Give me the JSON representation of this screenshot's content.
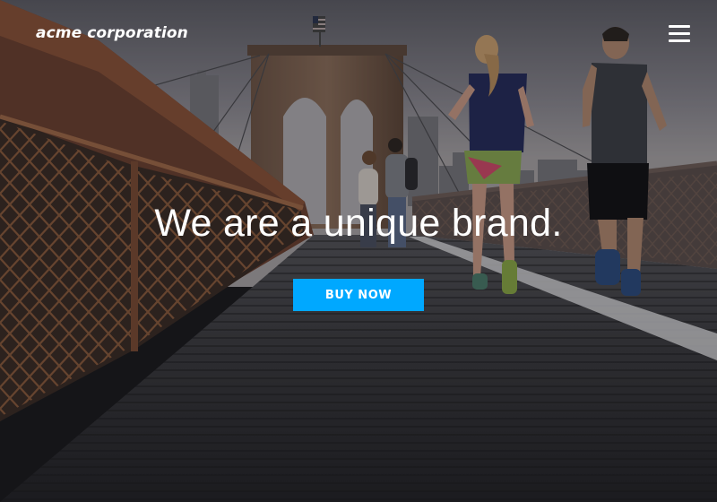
{
  "brand": {
    "logo_text": "acme corporation"
  },
  "nav": {
    "menu_icon": "hamburger-menu-icon"
  },
  "hero": {
    "headline": "We are a unique brand.",
    "cta_label": "BUY NOW",
    "background": "photo of runners on a wooden bridge walkway with a stone-arched suspension tower"
  },
  "colors": {
    "accent": "#00a8ff",
    "text": "#ffffff"
  }
}
